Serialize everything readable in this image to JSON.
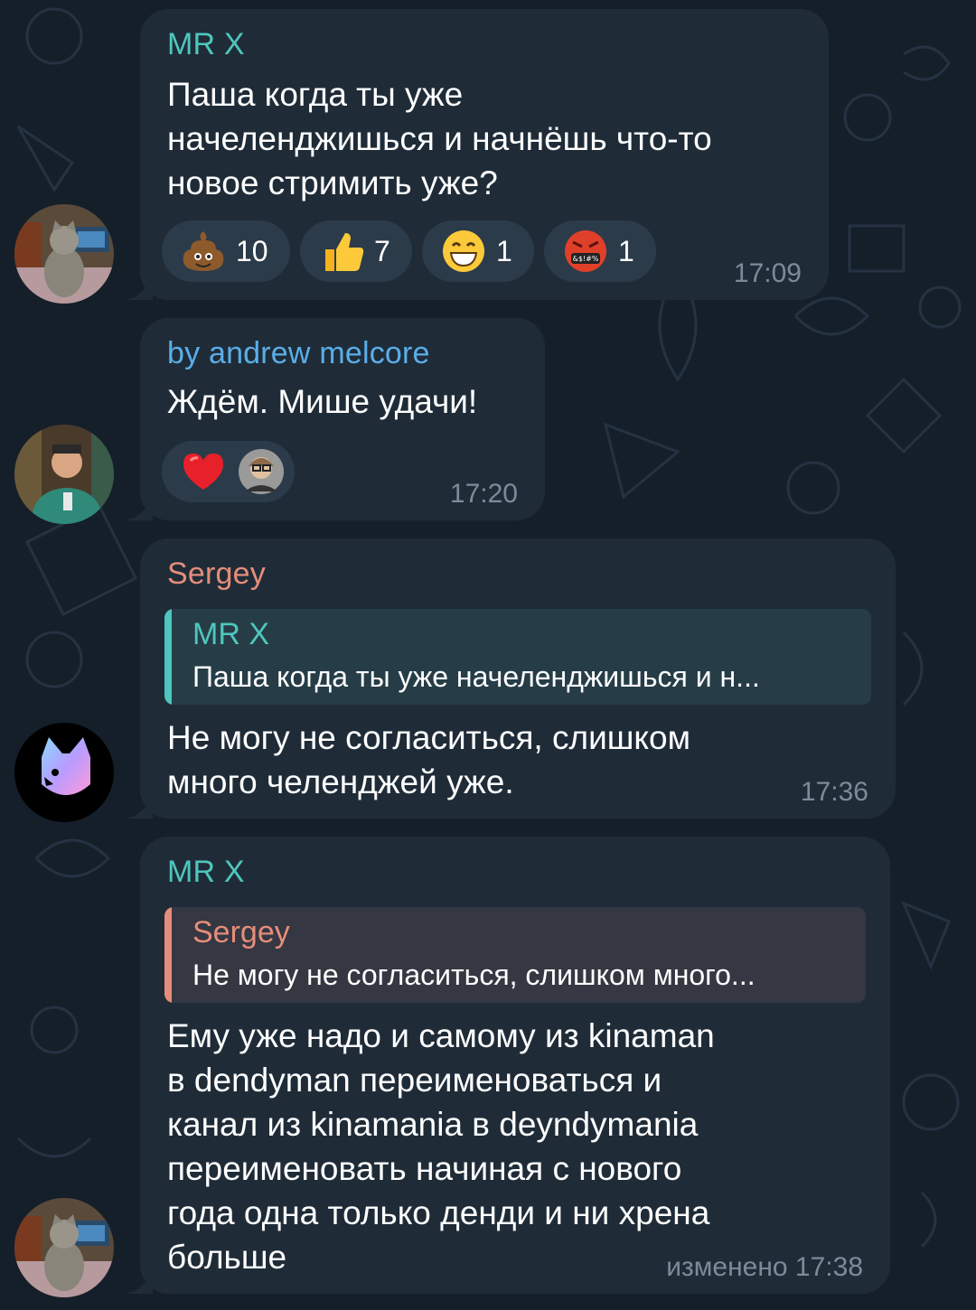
{
  "messages": [
    {
      "sender": "MR X",
      "lines": [
        "Паша когда ты уже",
        "начеленджишься и начнёшь что-то",
        "новое стримить уже?"
      ],
      "reactions": [
        {
          "icon": "poop-emoji",
          "count": "10"
        },
        {
          "icon": "thumbs-up-emoji",
          "count": "7"
        },
        {
          "icon": "grinning-face-emoji",
          "count": "1"
        },
        {
          "icon": "cursing-face-emoji",
          "count": "1"
        }
      ],
      "time": "17:09"
    },
    {
      "sender": "by andrew melcore",
      "lines": [
        "Ждём. Мише удачи!"
      ],
      "reactions": [
        {
          "icon": "red-heart-emoji"
        }
      ],
      "time": "17:20"
    },
    {
      "sender": "Sergey",
      "reply": {
        "name": "MR X",
        "text": "Паша когда ты уже начеленджишься и н..."
      },
      "lines": [
        "Не могу не согласиться, слишком",
        "много челенджей уже."
      ],
      "time": "17:36"
    },
    {
      "sender": "MR X",
      "reply": {
        "name": "Sergey",
        "text": "Не могу не согласиться, слишком много..."
      },
      "lines": [
        "Ему уже надо и самому из kinaman",
        "в dendyman переименоваться и",
        "канал из kinamania в deyndymania",
        "переименовать начиная с нового",
        "года одна только денди и ни хрена",
        "больше"
      ],
      "time": "изменено 17:38"
    }
  ],
  "colors": {
    "background": "#151f2a",
    "bubble": "#1f2c38",
    "mrx_name": "#4fc6bd",
    "andrew_name": "#5aaee8",
    "sergey_name": "#e58d7a",
    "time": "#7d8b99",
    "reaction_pill": "#2c3b49"
  }
}
